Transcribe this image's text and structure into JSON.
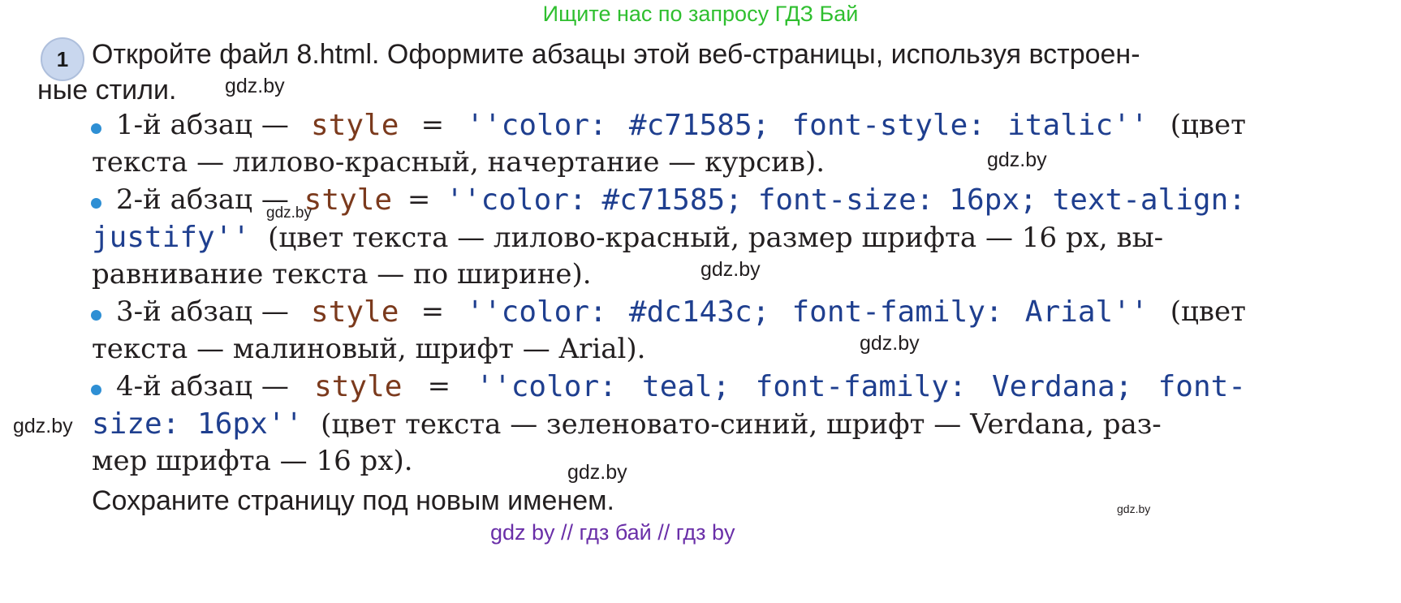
{
  "banner": "Ищите нас по запросу ГДЗ Бай",
  "task": {
    "number": "1",
    "intro_line1": "Откройте файл 8.html. Оформите абзацы этой веб-страницы, используя встроен-",
    "intro_line2": "ные стили."
  },
  "items": [
    {
      "label": "1-й абзац —",
      "kw": "style",
      "eq": "=",
      "codes": [
        "''color:",
        "#c71585;",
        "font-style:",
        "italic''"
      ],
      "paren_start": "(цвет",
      "cont": "текста — лилово-красный, начертание — курсив)."
    },
    {
      "label": "2-й абзац —",
      "kw": "style",
      "eq": "=",
      "codes": [
        "''color:",
        "#c71585;",
        "font-size:",
        "16px;",
        "text-align:"
      ],
      "line2_code": "justify''",
      "line2_text": "(цвет текста — лилово-красный, размер шрифта — 16 px, вы-",
      "line3_text": "равнивание текста — по ширине)."
    },
    {
      "label": "3-й абзац —",
      "kw": "style",
      "eq": "=",
      "codes": [
        "''color:",
        "#dc143c;",
        "font-family:",
        "Arial''"
      ],
      "paren_start": "(цвет",
      "cont": "текста — малиновый, шрифт — Arial)."
    },
    {
      "label": "4-й абзац —",
      "kw": "style",
      "eq": "=",
      "codes": [
        "''color:",
        "teal;",
        "font-family:",
        "Verdana;",
        "font-"
      ],
      "line2_code": "size: 16px''",
      "line2_text": "(цвет текста — зеленовато-синий, шрифт — Verdana, раз-",
      "line3_text": "мер шрифта — 16 px)."
    }
  ],
  "save_text": "Сохраните страницу под новым именем.",
  "watermark": "gdz.by",
  "footer": "gdz by  //  гдз бай  //  гдз by",
  "colors": {
    "banner": "#2fbf2f",
    "keyword": "#7b3a1d",
    "code": "#1f3f8f",
    "bullet": "#2e8fd4",
    "footer": "#6a2fa8"
  }
}
